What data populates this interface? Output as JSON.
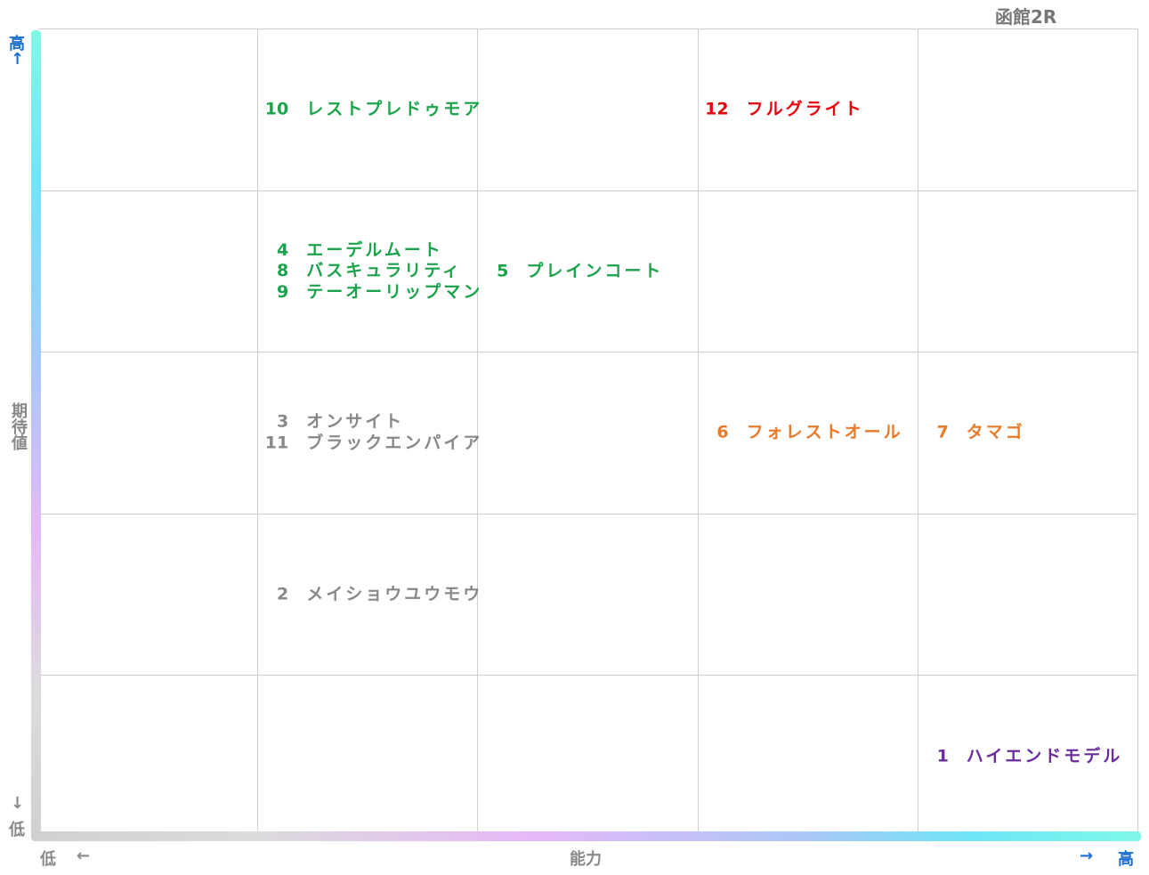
{
  "title": "函館2R",
  "axes": {
    "y_high": "高",
    "y_high_arrow": "↑",
    "y_low_arrow": "↓",
    "y_low": "低",
    "y_label": "期待値",
    "x_low": "低",
    "x_low_arrow": "←",
    "x_label": "能力",
    "x_high_arrow": "→",
    "x_high": "高"
  },
  "colors": {
    "green": "#1aa34a",
    "red": "#e8000b",
    "grey": "#888888",
    "orange": "#e87a2a",
    "purple": "#6a2c9c",
    "axis_blue": "#1a6fd0"
  },
  "chart_data": {
    "type": "table",
    "title": "函館2R",
    "xlabel": "能力",
    "ylabel": "期待値",
    "columns": 5,
    "rows": 5,
    "x_direction": "低 → 高",
    "y_direction": "低 → 高",
    "grid": true,
    "horses": [
      {
        "num": "10",
        "name": "レストプレドゥモア",
        "col": 2,
        "row": 5,
        "color": "green"
      },
      {
        "num": "12",
        "name": "フルグライト",
        "col": 4,
        "row": 5,
        "color": "red"
      },
      {
        "num": "4",
        "name": "エーデルムート",
        "col": 2,
        "row": 4,
        "color": "green"
      },
      {
        "num": "8",
        "name": "バスキュラリティ",
        "col": 2,
        "row": 4,
        "color": "green"
      },
      {
        "num": "9",
        "name": "テーオーリップマン",
        "col": 2,
        "row": 4,
        "color": "green"
      },
      {
        "num": "5",
        "name": "プレインコート",
        "col": 3,
        "row": 4,
        "color": "green"
      },
      {
        "num": "3",
        "name": "オンサイト",
        "col": 2,
        "row": 3,
        "color": "grey"
      },
      {
        "num": "11",
        "name": "ブラックエンパイア",
        "col": 2,
        "row": 3,
        "color": "grey"
      },
      {
        "num": "6",
        "name": "フォレストオール",
        "col": 4,
        "row": 3,
        "color": "orange"
      },
      {
        "num": "7",
        "name": "タマゴ",
        "col": 5,
        "row": 3,
        "color": "orange"
      },
      {
        "num": "2",
        "name": "メイショウユウモウ",
        "col": 2,
        "row": 2,
        "color": "grey"
      },
      {
        "num": "1",
        "name": "ハイエンドモデル",
        "col": 5,
        "row": 1,
        "color": "purple"
      }
    ]
  }
}
